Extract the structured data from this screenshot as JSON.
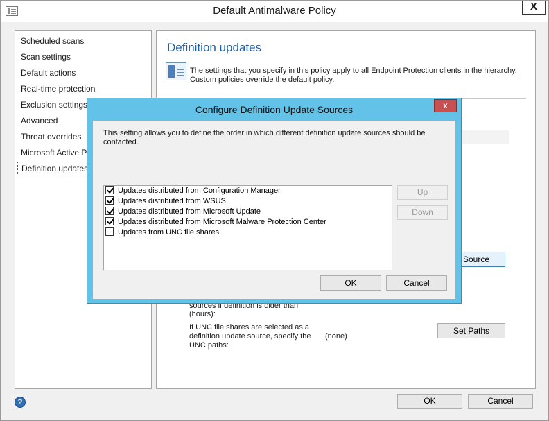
{
  "window": {
    "title": "Default Antimalware Policy",
    "close_label": "X"
  },
  "nav": {
    "items": [
      {
        "label": "Scheduled scans"
      },
      {
        "label": "Scan settings"
      },
      {
        "label": "Default actions"
      },
      {
        "label": "Real-time protection"
      },
      {
        "label": "Exclusion settings"
      },
      {
        "label": "Advanced"
      },
      {
        "label": "Threat overrides"
      },
      {
        "label": "Microsoft Active P"
      },
      {
        "label": "Definition updates",
        "selected": true
      }
    ]
  },
  "content": {
    "title": "Definition updates",
    "description": "The settings that you specify in this policy apply to all Endpoint Protection clients in the hierarchy. Custom policies override the default policy.",
    "source_button_label": "t Source",
    "hours_label": "sources if definition is older than (hours):",
    "unc_label": "If UNC file shares are selected as a definition update source, specify the UNC paths:",
    "unc_value": "(none)",
    "set_paths_label": "Set Paths"
  },
  "footer": {
    "help_icon": "?",
    "ok_label": "OK",
    "cancel_label": "Cancel"
  },
  "dialog": {
    "title": "Configure Definition Update Sources",
    "close_label": "x",
    "description": "This setting allows you to define the order in which different definition update sources should be contacted.",
    "sources": [
      {
        "label": "Updates distributed from Configuration Manager",
        "checked": true
      },
      {
        "label": "Updates distributed from WSUS",
        "checked": true
      },
      {
        "label": "Updates distributed from Microsoft Update",
        "checked": true
      },
      {
        "label": "Updates distributed from Microsoft Malware Protection Center",
        "checked": true
      },
      {
        "label": "Updates from UNC file shares",
        "checked": false
      }
    ],
    "up_label": "Up",
    "down_label": "Down",
    "ok_label": "OK",
    "cancel_label": "Cancel"
  }
}
